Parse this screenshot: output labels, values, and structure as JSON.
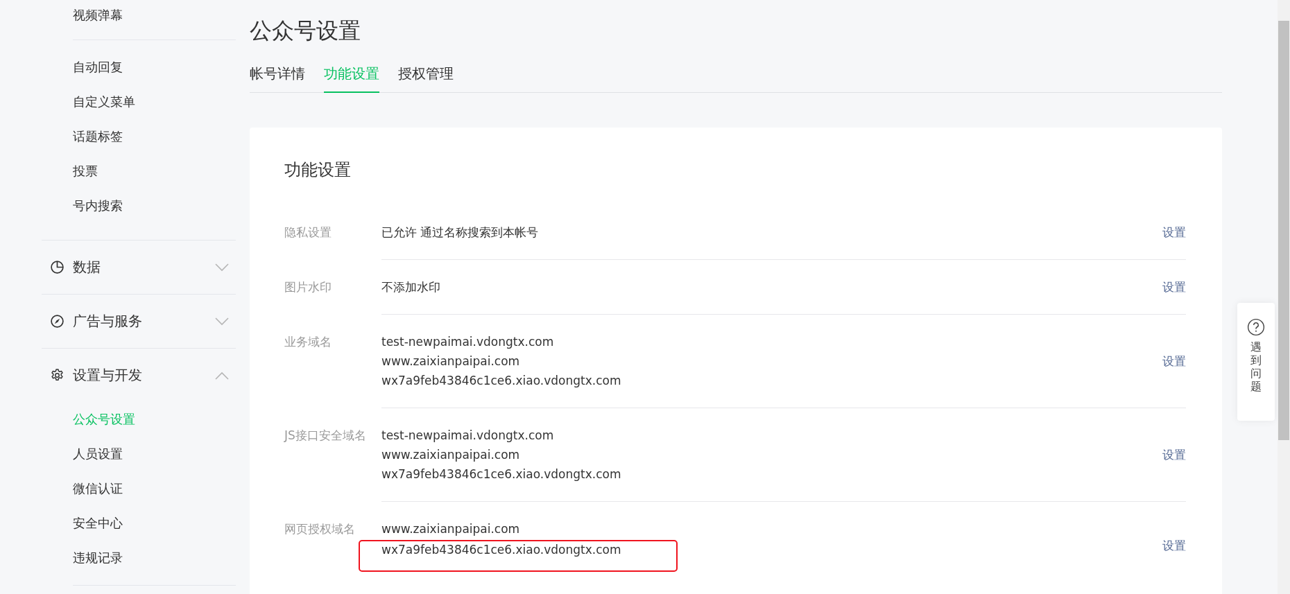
{
  "sidebar": {
    "sections": [
      {
        "kind": "list",
        "items": [
          {
            "label": "视频弹幕",
            "selected": false
          }
        ]
      },
      {
        "kind": "list",
        "items": [
          {
            "label": "自动回复",
            "selected": false
          },
          {
            "label": "自定义菜单",
            "selected": false
          },
          {
            "label": "话题标签",
            "selected": false
          },
          {
            "label": "投票",
            "selected": false
          },
          {
            "label": "号内搜索",
            "selected": false
          }
        ]
      },
      {
        "kind": "group",
        "title": "数据",
        "expanded": false
      },
      {
        "kind": "group",
        "title": "广告与服务",
        "expanded": false
      },
      {
        "kind": "group",
        "title": "设置与开发",
        "expanded": true,
        "items": [
          {
            "label": "公众号设置",
            "selected": true
          },
          {
            "label": "人员设置",
            "selected": false
          },
          {
            "label": "微信认证",
            "selected": false
          },
          {
            "label": "安全中心",
            "selected": false
          },
          {
            "label": "违规记录",
            "selected": false
          }
        ]
      }
    ]
  },
  "page": {
    "title": "公众号设置"
  },
  "tabs": [
    {
      "label": "帐号详情",
      "selected": false
    },
    {
      "label": "功能设置",
      "selected": true
    },
    {
      "label": "授权管理",
      "selected": false
    }
  ],
  "card": {
    "title": "功能设置",
    "rows": [
      {
        "label": "隐私设置",
        "values": [
          {
            "text": "已允许 通过名称搜索到本帐号",
            "highlighted": false
          }
        ],
        "action": "设置"
      },
      {
        "label": "图片水印",
        "values": [
          {
            "text": "不添加水印",
            "highlighted": false
          }
        ],
        "action": "设置"
      },
      {
        "label": "业务域名",
        "values": [
          {
            "text": "test-newpaimai.vdongtx.com",
            "highlighted": false
          },
          {
            "text": "www.zaixianpaipai.com",
            "highlighted": false
          },
          {
            "text": "wx7a9feb43846c1ce6.xiao.vdongtx.com",
            "highlighted": false
          }
        ],
        "action": "设置"
      },
      {
        "label": "JS接口安全域名",
        "values": [
          {
            "text": "test-newpaimai.vdongtx.com",
            "highlighted": false
          },
          {
            "text": "www.zaixianpaipai.com",
            "highlighted": false
          },
          {
            "text": "wx7a9feb43846c1ce6.xiao.vdongtx.com",
            "highlighted": false
          }
        ],
        "action": "设置"
      },
      {
        "label": "网页授权域名",
        "values": [
          {
            "text": "www.zaixianpaipai.com",
            "highlighted": false
          },
          {
            "text": "wx7a9feb43846c1ce6.xiao.vdongtx.com",
            "highlighted": true
          }
        ],
        "action": "设置"
      }
    ]
  },
  "help": {
    "chars": [
      "遇",
      "到",
      "问",
      "题"
    ]
  }
}
